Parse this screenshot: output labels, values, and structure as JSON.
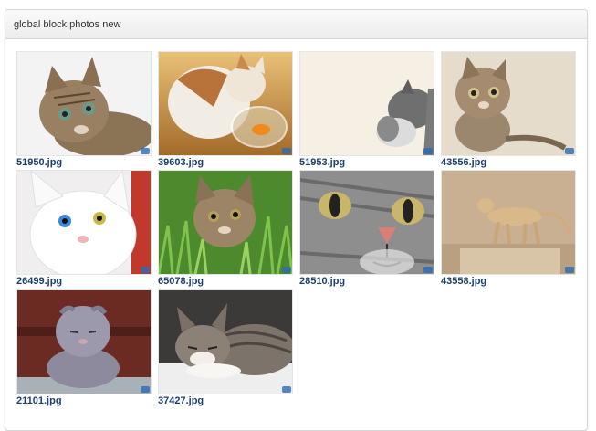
{
  "panel": {
    "title": "global block photos new"
  },
  "photos": [
    {
      "filename": "51950.jpg",
      "subject": "tabby kitten lying on white"
    },
    {
      "filename": "39603.jpg",
      "subject": "calico cat with goldfish bowl"
    },
    {
      "filename": "51953.jpg",
      "subject": "grey kitten at edge of frame"
    },
    {
      "filename": "43556.jpg",
      "subject": "tabby cat looking up"
    },
    {
      "filename": "26499.jpg",
      "subject": "white cat with odd eyes"
    },
    {
      "filename": "65078.jpg",
      "subject": "tabby kitten in grass"
    },
    {
      "filename": "28510.jpg",
      "subject": "grey tabby face close-up"
    },
    {
      "filename": "43558.jpg",
      "subject": "ginger cat walking on wall"
    },
    {
      "filename": "21101.jpg",
      "subject": "grey scottish fold cat"
    },
    {
      "filename": "37427.jpg",
      "subject": "tabby kitten sleeping"
    }
  ]
}
